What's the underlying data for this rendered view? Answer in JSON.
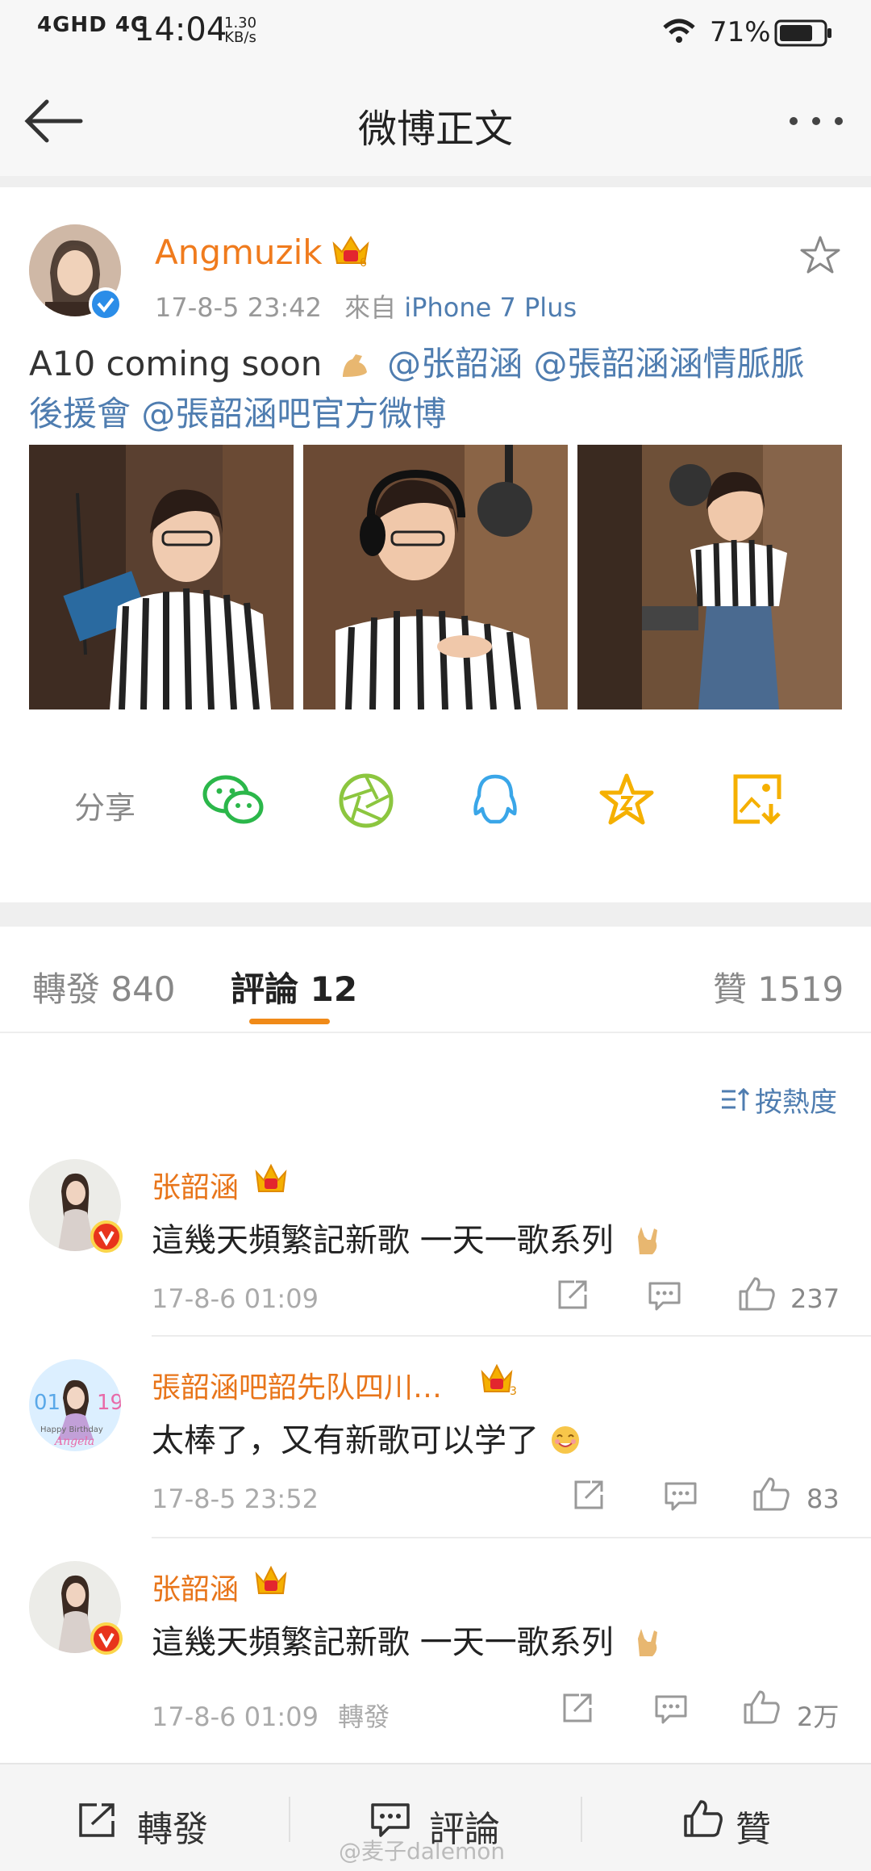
{
  "status_bar": {
    "network": "4GHD 4G",
    "time": "14:04",
    "speed": "1.30",
    "speed_unit": "KB/s",
    "battery": "71%"
  },
  "nav": {
    "title": "微博正文"
  },
  "post": {
    "author": "Angmuzik",
    "crown_level": "6",
    "timestamp": "17-8-5 23:42",
    "source_prefix": "來自",
    "source": "iPhone 7 Plus",
    "text": "A10 coming soon",
    "mentions": [
      "@张韶涵",
      "@張韶涵涵情脈脈後援會",
      "@張韶涵吧官方微博"
    ],
    "mention_line2": "後援會 @張韶涵吧官方微博",
    "mention_line1": "@张韶涵 @張韶涵涵情脈脈",
    "share_label": "分享"
  },
  "tabs": {
    "repost": "轉發 840",
    "comments": "評論 12",
    "likes": "贊 1519",
    "sort": "按熱度"
  },
  "comments": [
    {
      "name": "张韶涵",
      "text": "這幾天頻繁記新歌 一天一歌系列",
      "time": "17-8-6 01:09",
      "likes": "237",
      "extra": ""
    },
    {
      "name": "張韶涵吧韶先队四川…",
      "text": "太棒了，又有新歌可以学了",
      "time": "17-8-5 23:52",
      "likes": "83",
      "extra": "",
      "crown_level": "3"
    },
    {
      "name": "张韶涵",
      "text": "這幾天頻繁記新歌 一天一歌系列",
      "time": "17-8-6 01:09",
      "likes": "2万",
      "extra": "轉發"
    }
  ],
  "bottom_bar": {
    "repost": "轉發",
    "comment": "評論",
    "like": "贊"
  },
  "watermark": "@麦子dalemon",
  "colors": {
    "orange": "#f07b1d",
    "link_blue": "#4f7db0",
    "wechat_green": "#2bb74a",
    "moments_green": "#8cc63f",
    "qq_blue": "#3aa6e8",
    "gold": "#f5b000"
  },
  "avatar_1_text": "01",
  "avatar_1_text2": "19",
  "avatar_1_caption": "Happy Birthday",
  "avatar_1_name": "Angela"
}
